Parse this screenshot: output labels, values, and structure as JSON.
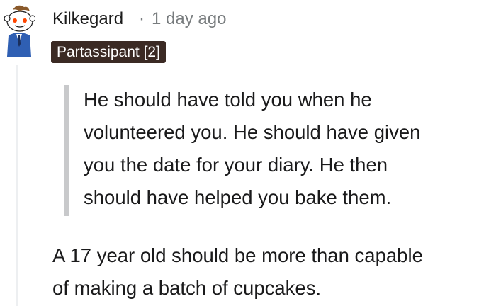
{
  "comment": {
    "author": "Kilkegard",
    "separator": "·",
    "timestamp": "1 day ago",
    "flair": "Partassipant [2]",
    "quote_lines": [
      "He should have told you when he",
      "volunteered you. He should have given",
      "you the date for your diary. He then",
      "should have helped you bake them."
    ],
    "body_lines": [
      "A 17 year old should be more than capable",
      "of making a batch of cupcakes."
    ],
    "avatar_icon": "snoo-avatar-icon",
    "colors": {
      "flair_bg": "#3b2a24",
      "flair_text": "#ffffff",
      "meta": "#787c7e",
      "quote_bar": "#c8c9cb",
      "thread_line": "#edeff1"
    }
  }
}
